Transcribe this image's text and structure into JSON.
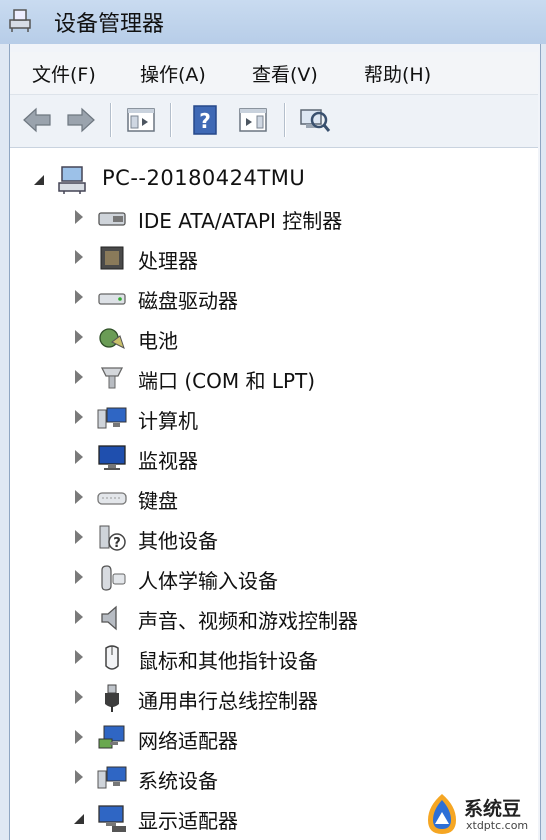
{
  "window": {
    "title": "设备管理器"
  },
  "menu": [
    "文件(F)",
    "操作(A)",
    "查看(V)",
    "帮助(H)"
  ],
  "toolbar": {
    "buttons": [
      "back-icon",
      "forward-icon",
      "properties-pane-icon",
      "help-icon",
      "show-hide-console-tree-icon",
      "scan-hardware-icon"
    ]
  },
  "tree": {
    "root": {
      "label": "PC--20180424TMU",
      "icon": "computer-tree-icon"
    },
    "items": [
      {
        "label": "IDE ATA/ATAPI 控制器",
        "icon": "ide-controller-icon"
      },
      {
        "label": "处理器",
        "icon": "processor-icon"
      },
      {
        "label": "磁盘驱动器",
        "icon": "disk-drive-icon"
      },
      {
        "label": "电池",
        "icon": "battery-icon"
      },
      {
        "label": "端口 (COM 和 LPT)",
        "icon": "port-icon"
      },
      {
        "label": "计算机",
        "icon": "computer-icon"
      },
      {
        "label": "监视器",
        "icon": "monitor-icon"
      },
      {
        "label": "键盘",
        "icon": "keyboard-icon"
      },
      {
        "label": "其他设备",
        "icon": "other-devices-icon"
      },
      {
        "label": "人体学输入设备",
        "icon": "hid-icon"
      },
      {
        "label": "声音、视频和游戏控制器",
        "icon": "sound-icon"
      },
      {
        "label": "鼠标和其他指针设备",
        "icon": "mouse-icon"
      },
      {
        "label": "通用串行总线控制器",
        "icon": "usb-icon"
      },
      {
        "label": "网络适配器",
        "icon": "network-adapter-icon"
      },
      {
        "label": "系统设备",
        "icon": "system-devices-icon"
      },
      {
        "label": "显示适配器",
        "icon": "display-adapter-icon"
      }
    ]
  },
  "watermark": {
    "name": "系统豆",
    "url": "xtdptc.com"
  }
}
